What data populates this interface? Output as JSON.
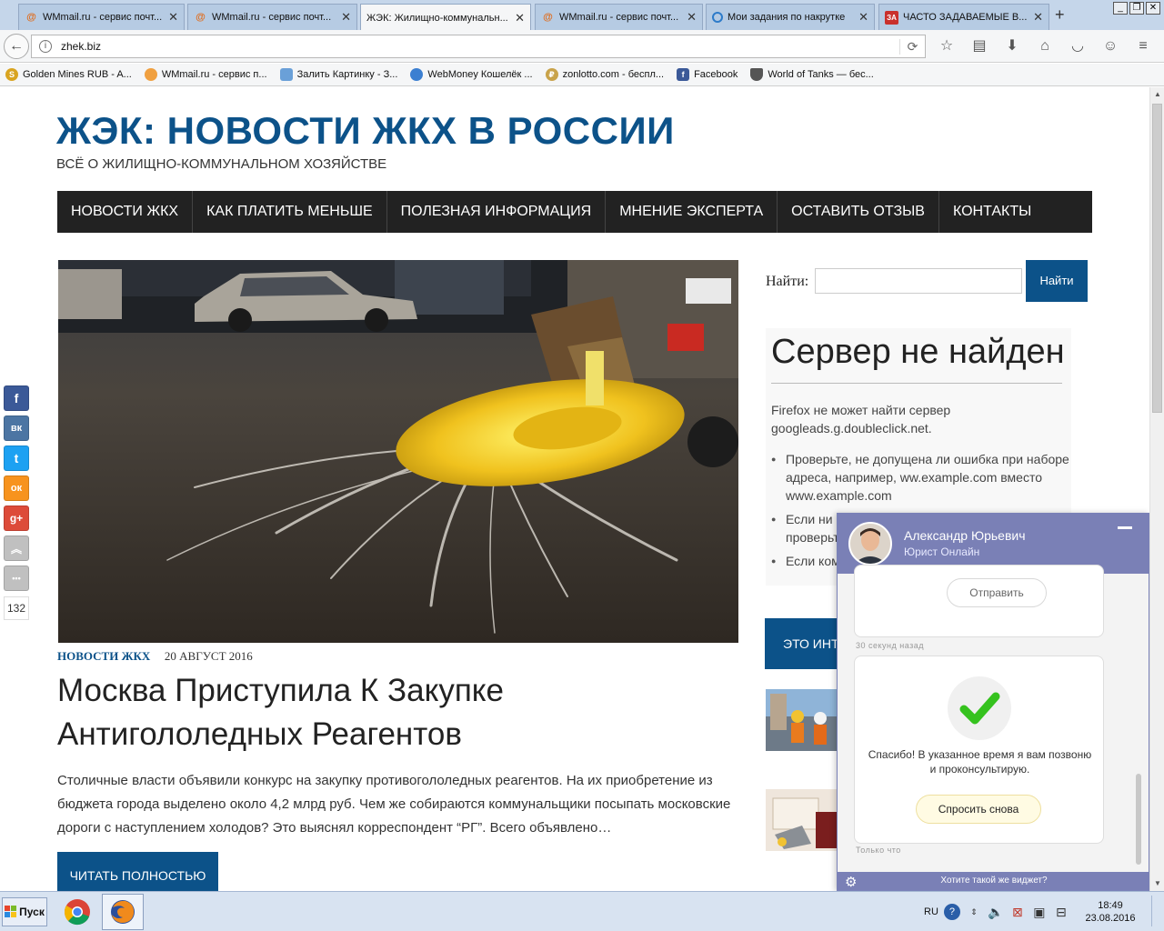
{
  "browser": {
    "tabs": [
      {
        "label": "WMmail.ru - сервис почт...",
        "icon": "at-icon",
        "active": false
      },
      {
        "label": "WMmail.ru - сервис почт...",
        "icon": "at-icon",
        "active": false
      },
      {
        "label": "ЖЭК: Жилищно-коммунальн...",
        "icon": "",
        "active": true
      },
      {
        "label": "WMmail.ru - сервис почт...",
        "icon": "at-icon",
        "active": false
      },
      {
        "label": "Мои задания по накрутке",
        "icon": "target-icon",
        "active": false
      },
      {
        "label": "ЧАСТО ЗАДАВАЕМЫЕ В...",
        "icon": "za-icon",
        "active": false
      }
    ],
    "za_badge": "ЗА",
    "url": "zhek.biz",
    "bookmarks": [
      {
        "label": "Golden Mines RUB - A...",
        "icon": "coin-icon",
        "color": "#d9a420"
      },
      {
        "label": "WMmail.ru - сервис п...",
        "icon": "egg-icon",
        "color": "#f0a040"
      },
      {
        "label": "Залить Картинку - З...",
        "icon": "image-icon",
        "color": "#6aa0d8"
      },
      {
        "label": "WebMoney Кошелёк ...",
        "icon": "webmoney-icon",
        "color": "#3b7fd1"
      },
      {
        "label": "zonlotto.com - беспл...",
        "icon": "zonlotto-icon",
        "color": "#c9a34a"
      },
      {
        "label": "Facebook",
        "icon": "facebook-icon",
        "color": "#3b5998"
      },
      {
        "label": "World of Tanks — бес...",
        "icon": "wot-icon",
        "color": "#555555"
      }
    ],
    "bookmark_glyphs": [
      "S",
      "",
      "",
      "",
      "₽",
      "f",
      ""
    ]
  },
  "site": {
    "title": "ЖЭК: НОВОСТИ ЖКХ В РОССИИ",
    "tagline": "ВСЁ О ЖИЛИЩНО-КОММУНАЛЬНОМ ХОЗЯЙСТВЕ",
    "nav": [
      "НОВОСТИ ЖКХ",
      "КАК ПЛАТИТЬ МЕНЬШЕ",
      "ПОЛЕЗНАЯ ИНФОРМАЦИЯ",
      "МНЕНИЕ ЭКСПЕРТА",
      "ОСТАВИТЬ ОТЗЫВ",
      "КОНТАКТЫ"
    ],
    "accent": "#0c5289"
  },
  "post": {
    "category": "НОВОСТИ ЖКХ",
    "date": "20 АВГУСТ 2016",
    "title": "Москва Приступила К Закупке Антигололедных Реагентов",
    "excerpt": "Столичные власти объявили конкурс на закупку противогололедных реагентов. На их приобретение из бюджета города выделено около 4,2 млрд руб. Чем же собираются коммунальщики посыпать московские дороги с наступлением холодов? Это выяснял корреспондент “РГ”. Всего объявлено…",
    "read_more": "ЧИТАТЬ ПОЛНОСТЬЮ"
  },
  "sidebar": {
    "search_label": "Найти:",
    "search_value": "",
    "search_button": "Найти",
    "error": {
      "title": "Сервер не найден",
      "description": "Firefox не может найти сервер googleads.g.doubleclick.net.",
      "items": [
        "Проверьте, не допущена ли ошибка при наборе адреса, например, ww.example.com вместо www.example.com",
        "Если ни одна из страниц не открывается, проверьте свое подключение к Интернету.",
        "Если компьютер или сеть защищены"
      ]
    },
    "blue_box": "ЭТО ИНТ"
  },
  "share": {
    "buttons": [
      {
        "name": "facebook",
        "glyph": "f",
        "color": "#3b5998"
      },
      {
        "name": "vkontakte",
        "glyph": "вк",
        "color": "#4c75a3"
      },
      {
        "name": "twitter",
        "glyph": "t",
        "color": "#1da1f2"
      },
      {
        "name": "odnoklassniki",
        "glyph": "ок",
        "color": "#f7931e"
      },
      {
        "name": "google-plus",
        "glyph": "g+",
        "color": "#dd4b39"
      },
      {
        "name": "scroll-up",
        "glyph": "︽",
        "color": "#c0c0c0"
      },
      {
        "name": "more",
        "glyph": "•••",
        "color": "#c0c0c0"
      }
    ],
    "count": "132"
  },
  "chat": {
    "agent_name": "Александр Юрьевич",
    "agent_role": "Юрист Онлайн",
    "send_button": "Отправить",
    "time1": "30 секунд назад",
    "thanks": "Спасибо! В указанное время я вам позвоню и проконсультирую.",
    "ask_again": "Спросить снова",
    "time2": "Только что",
    "promo": "Хотите такой же виджет?"
  },
  "taskbar": {
    "start": "Пуск",
    "lang": "RU",
    "time": "18:49",
    "date": "23.08.2016"
  }
}
